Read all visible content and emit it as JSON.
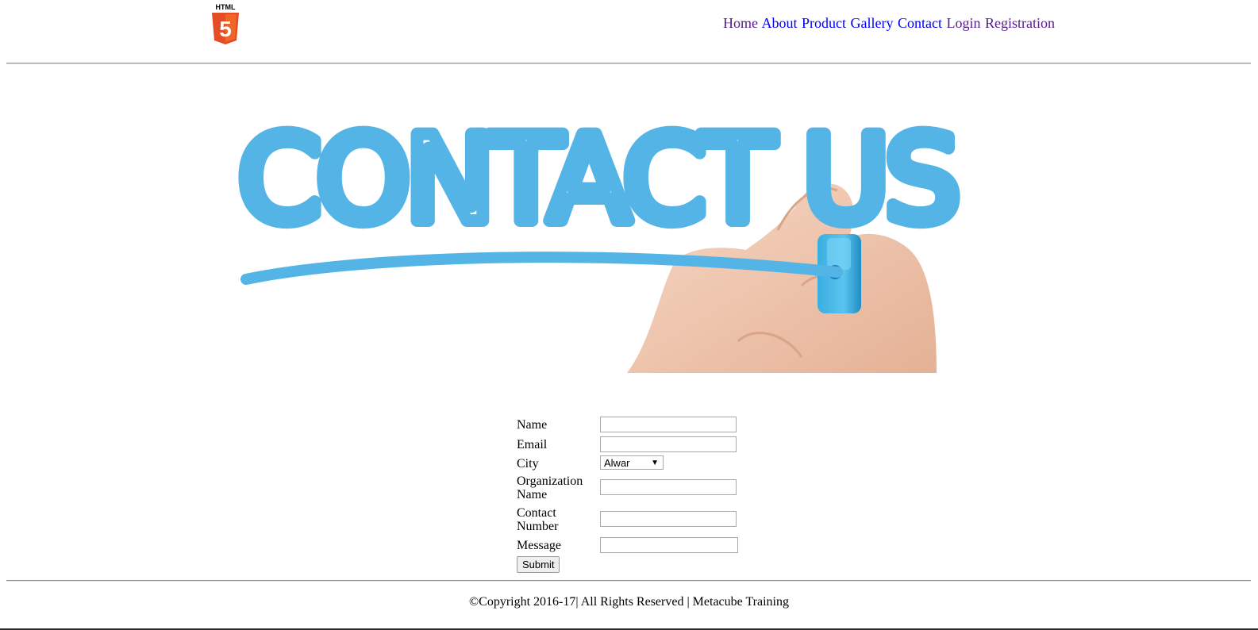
{
  "header": {
    "logo_text": "HTML",
    "logo_number": "5",
    "nav": [
      {
        "label": "Home",
        "state": "visited"
      },
      {
        "label": "About",
        "state": "unvisited"
      },
      {
        "label": "Product",
        "state": "unvisited"
      },
      {
        "label": "Gallery",
        "state": "unvisited"
      },
      {
        "label": "Contact",
        "state": "unvisited"
      },
      {
        "label": "Login",
        "state": "visited"
      },
      {
        "label": "Registration",
        "state": "visited"
      }
    ]
  },
  "hero": {
    "text": "CONTACT US",
    "color": "#55b4e6"
  },
  "form": {
    "name_label": "Name",
    "email_label": "Email",
    "city_label": "City",
    "city_selected": "Alwar",
    "org_label_line1": "Organization",
    "org_label_line2": "Name",
    "contact_label_line1": "Contact",
    "contact_label_line2": "Number",
    "message_label": "Message",
    "submit_label": "Submit"
  },
  "footer": {
    "text": "©Copyright 2016-17| All Rights Reserved | Metacube Training"
  },
  "colors": {
    "link": "#0000ee",
    "visited": "#551a8b",
    "html5_orange": "#e44d26",
    "html5_light": "#f16529"
  }
}
